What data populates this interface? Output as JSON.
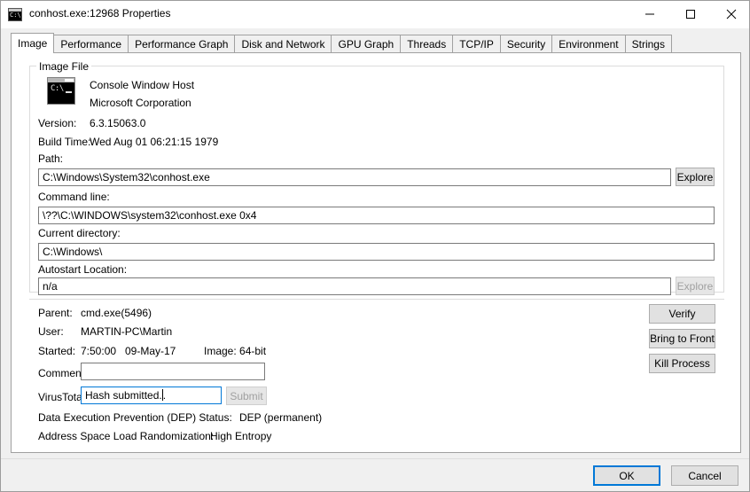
{
  "window": {
    "title": "conhost.exe:12968 Properties",
    "icon": "console-window-icon",
    "controls": {
      "minimize": "minimize-icon",
      "maximize": "maximize-icon",
      "close": "close-icon"
    }
  },
  "tabs": [
    {
      "label": "Image",
      "selected": true
    },
    {
      "label": "Performance",
      "selected": false
    },
    {
      "label": "Performance Graph",
      "selected": false
    },
    {
      "label": "Disk and Network",
      "selected": false
    },
    {
      "label": "GPU Graph",
      "selected": false
    },
    {
      "label": "Threads",
      "selected": false
    },
    {
      "label": "TCP/IP",
      "selected": false
    },
    {
      "label": "Security",
      "selected": false
    },
    {
      "label": "Environment",
      "selected": false
    },
    {
      "label": "Strings",
      "selected": false
    }
  ],
  "image_file": {
    "group_label": "Image File",
    "icon_prompt": "C:\\",
    "product_name": "Console Window Host",
    "company_name": "Microsoft Corporation",
    "version_label": "Version:",
    "version_value": "6.3.15063.0",
    "build_time_label": "Build Time:",
    "build_time_value": "Wed Aug 01 06:21:15 1979",
    "path_label": "Path:",
    "path_value": "C:\\Windows\\System32\\conhost.exe",
    "path_explore_label": "Explore",
    "command_line_label": "Command line:",
    "command_line_value": "\\??\\C:\\WINDOWS\\system32\\conhost.exe 0x4",
    "current_directory_label": "Current directory:",
    "current_directory_value": "C:\\Windows\\",
    "autostart_label": "Autostart Location:",
    "autostart_value": "n/a",
    "autostart_explore_label": "Explore",
    "autostart_explore_disabled": true
  },
  "details": {
    "parent_label": "Parent:",
    "parent_value": "cmd.exe(5496)",
    "user_label": "User:",
    "user_value": "MARTIN-PC\\Martin",
    "started_label": "Started:",
    "started_time": "7:50:00",
    "started_date": "09-May-17",
    "image_bitness": "Image: 64-bit",
    "comment_label": "Comment:",
    "comment_value": "",
    "comment_placeholder": "",
    "virustotal_label": "VirusTotal:",
    "virustotal_value_before_caret": "Hash submitted.",
    "virustotal_value_after_caret": ".",
    "virustotal_value": "Hash submitted...",
    "submit_label": "Submit",
    "submit_disabled": true,
    "dep_label": "Data Execution Prevention (DEP) Status:",
    "dep_value": "DEP (permanent)",
    "aslr_label": "Address Space Load Randomization:",
    "aslr_value": "High Entropy"
  },
  "actions": {
    "verify_label": "Verify",
    "bring_to_front_label": "Bring to Front",
    "kill_process_label": "Kill Process"
  },
  "footer": {
    "ok_label": "OK",
    "cancel_label": "Cancel"
  },
  "colors": {
    "accent": "#0078d7",
    "window_bg": "#f0f0f0",
    "page_bg": "#ffffff",
    "button_bg": "#e1e1e1"
  }
}
